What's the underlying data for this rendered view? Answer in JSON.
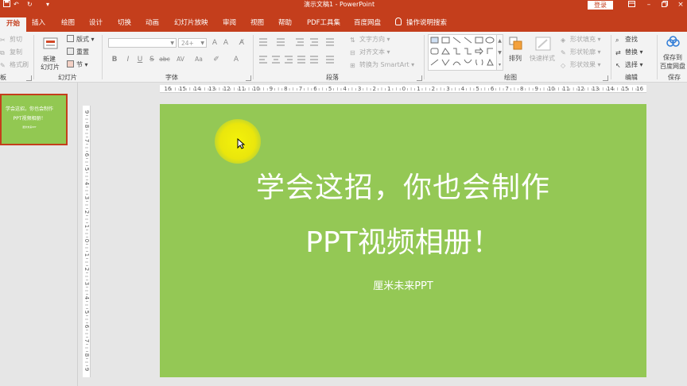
{
  "titlebar": {
    "title": "演示文稿1 - PowerPoint",
    "login": "登录",
    "qa_icons": [
      "save-icon",
      "undo-icon",
      "customize-icon"
    ],
    "window_controls": [
      "ribbon-display-icon",
      "minimize-icon",
      "restore-icon",
      "close-icon"
    ]
  },
  "tabs": {
    "items": [
      {
        "label": "开始",
        "active": true
      },
      {
        "label": "插入"
      },
      {
        "label": "绘图"
      },
      {
        "label": "设计"
      },
      {
        "label": "切换"
      },
      {
        "label": "动画"
      },
      {
        "label": "幻灯片放映"
      },
      {
        "label": "审阅"
      },
      {
        "label": "视图"
      },
      {
        "label": "帮助"
      },
      {
        "label": "PDF工具集"
      },
      {
        "label": "百度网盘"
      }
    ],
    "tell_me": "操作说明搜索"
  },
  "ribbon": {
    "clipboard": {
      "cut": "剪切",
      "copy": "复制",
      "format_painter": "格式刷",
      "label": "板"
    },
    "slides": {
      "new_slide_line1": "新建",
      "new_slide_line2": "幻灯片",
      "layout": "版式",
      "reset": "重置",
      "section": "节",
      "label": "幻灯片"
    },
    "font": {
      "font_size": "24+",
      "buttons": [
        "B",
        "I",
        "U",
        "S",
        "abc",
        "AV",
        "Aa",
        "A"
      ],
      "label": "字体"
    },
    "paragraph": {
      "text_direction": "文字方向",
      "align_text": "对齐文本",
      "smartart": "转换为 SmartArt",
      "label": "段落"
    },
    "drawing": {
      "arrange": "排列",
      "quick_styles": "快速样式",
      "shape_fill": "形状填充",
      "shape_outline": "形状轮廓",
      "shape_effects": "形状效果",
      "label": "绘图"
    },
    "editing": {
      "find": "查找",
      "replace": "替换",
      "select": "选择",
      "label": "编辑"
    },
    "save": {
      "line1": "保存到",
      "line2": "百度网盘",
      "label": "保存"
    }
  },
  "ruler": {
    "horizontal": [
      "16",
      "15",
      "14",
      "13",
      "12",
      "11",
      "10",
      "9",
      "8",
      "7",
      "6",
      "5",
      "4",
      "3",
      "2",
      "1",
      "0",
      "1",
      "2",
      "3",
      "4",
      "5",
      "6",
      "7",
      "8",
      "9",
      "10",
      "11",
      "12",
      "13",
      "14",
      "15",
      "16"
    ],
    "vertical": [
      "9",
      "8",
      "7",
      "6",
      "5",
      "4",
      "3",
      "2",
      "1",
      "0",
      "1",
      "2",
      "3",
      "4",
      "5",
      "6",
      "7",
      "8",
      "9"
    ]
  },
  "thumbnail": {
    "line1": "学会这招，你也会制作",
    "line2": "PPT视频相册！",
    "line3": "厘米未来PPT"
  },
  "slide": {
    "title_line1": "学会这招，你也会制作",
    "title_line2": "PPT视频相册！",
    "subtitle": "厘米未来PPT",
    "background_color": "#94c855"
  },
  "colors": {
    "accent": "#c43e1c",
    "ribbon_bg": "#f3f3f3",
    "slide_bg": "#94c855",
    "highlight": "#f4f20a"
  }
}
